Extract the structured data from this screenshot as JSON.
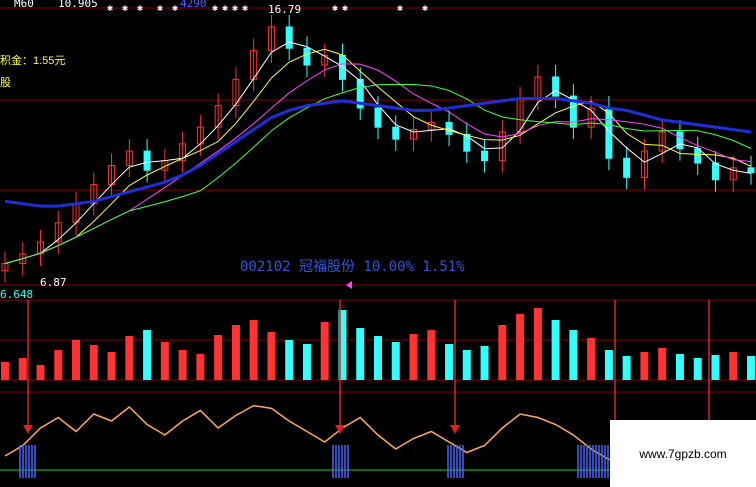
{
  "header": {
    "ma_label": "M60",
    "ma_value": "10.905",
    "partial_value": "4290"
  },
  "annotations": {
    "text1": "积金：1.55元",
    "text2": "股",
    "peak": "16.79",
    "low": "6.87",
    "axis_value": "6.648",
    "overlay": "002102 冠福股份 10.00% 1.51%"
  },
  "watermark": "www.7gpzb.com",
  "colors": {
    "up": "#ff3333",
    "down": "#33ffff",
    "ma_long": "#1f2fd8",
    "oscillator": "#ffaa55",
    "signal": "#22cc22",
    "arrow": "#dd2222",
    "grid": "#880000",
    "text": "#ffff33"
  },
  "chart_data": [
    {
      "type": "candlestick",
      "panel": "price",
      "title": "",
      "series": [
        {
          "name": "Close (approx)",
          "values": [
            6.9,
            7.3,
            7.8,
            8.6,
            9.4,
            10.2,
            11.0,
            11.6,
            10.8,
            11.2,
            11.9,
            12.6,
            13.5,
            14.6,
            15.8,
            16.79,
            15.9,
            15.2,
            15.6,
            14.6,
            13.4,
            12.6,
            12.1,
            12.5,
            12.8,
            12.3,
            11.6,
            11.2,
            12.4,
            13.8,
            14.7,
            13.9,
            12.6,
            13.4,
            11.3,
            10.5,
            11.6,
            12.4,
            11.7,
            11.1,
            10.4,
            10.9,
            10.7
          ]
        },
        {
          "name": "Long MA (blue)",
          "values": [
            9.5,
            9.4,
            9.3,
            9.3,
            9.4,
            9.5,
            9.7,
            9.9,
            10.1,
            10.3,
            10.6,
            11.0,
            11.5,
            12.0,
            12.5,
            13.0,
            13.3,
            13.5,
            13.6,
            13.7,
            13.6,
            13.5,
            13.4,
            13.3,
            13.3,
            13.4,
            13.5,
            13.6,
            13.7,
            13.8,
            13.8,
            13.8,
            13.7,
            13.6,
            13.4,
            13.3,
            13.1,
            12.9,
            12.8,
            12.7,
            12.6,
            12.5,
            12.4
          ]
        }
      ]
    },
    {
      "type": "bar",
      "panel": "volume",
      "values": [
        18,
        22,
        15,
        30,
        40,
        35,
        28,
        44,
        50,
        38,
        30,
        26,
        45,
        55,
        60,
        48,
        40,
        36,
        58,
        70,
        52,
        44,
        38,
        46,
        50,
        36,
        30,
        34,
        55,
        66,
        72,
        60,
        50,
        42,
        30,
        24,
        28,
        32,
        26,
        22,
        25,
        28,
        24
      ]
    },
    {
      "type": "line",
      "panel": "oscillator",
      "values": [
        20,
        35,
        60,
        75,
        55,
        80,
        70,
        90,
        65,
        50,
        70,
        85,
        60,
        78,
        92,
        88,
        70,
        55,
        40,
        60,
        75,
        50,
        30,
        45,
        55,
        40,
        25,
        35,
        60,
        80,
        75,
        65,
        50,
        30,
        15,
        20,
        40,
        55,
        45,
        35,
        50,
        30,
        40
      ]
    }
  ]
}
